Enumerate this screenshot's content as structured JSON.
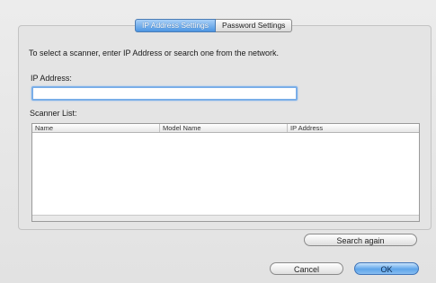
{
  "tabs": [
    {
      "label": "IP Address Settings",
      "selected": true
    },
    {
      "label": "Password Settings",
      "selected": false
    }
  ],
  "instruction": "To select a scanner, enter IP Address or search one from the network.",
  "ip_field": {
    "label": "IP Address:",
    "value": ""
  },
  "scanner_list": {
    "label": "Scanner List:",
    "columns": [
      "Name",
      "Model Name",
      "IP Address"
    ],
    "rows": []
  },
  "buttons": {
    "search_again": "Search again",
    "cancel": "Cancel",
    "ok": "OK"
  },
  "colors": {
    "accent": "#4c96e3",
    "focus_ring": "#7aaee8"
  }
}
